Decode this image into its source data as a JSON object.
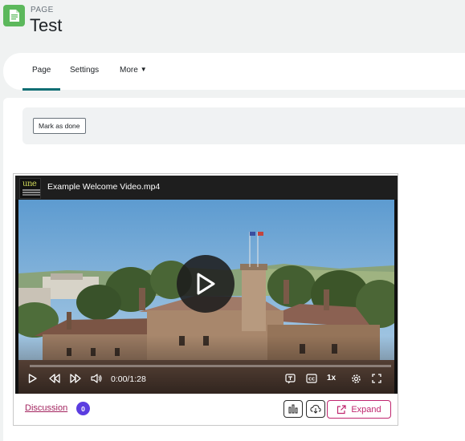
{
  "header": {
    "kicker": "PAGE",
    "title": "Test",
    "icon": "page-document-icon",
    "icon_color": "#5cb85c"
  },
  "tabs": [
    {
      "label": "Page",
      "active": true
    },
    {
      "label": "Settings",
      "active": false
    },
    {
      "label": "More",
      "active": false
    }
  ],
  "activity": {
    "mark_done_label": "Mark as done"
  },
  "video": {
    "title": "Example Welcome Video.mp4",
    "logo_text": "une",
    "time": "0:00/1:28",
    "speed": "1x",
    "progress": 0
  },
  "footer": {
    "discussion_label": "Discussion",
    "discussion_count": "0",
    "expand_label": "Expand"
  },
  "colors": {
    "accent": "#0f6e73",
    "link": "#a3245f",
    "expand": "#c0266f",
    "badge": "#5b3de0"
  }
}
